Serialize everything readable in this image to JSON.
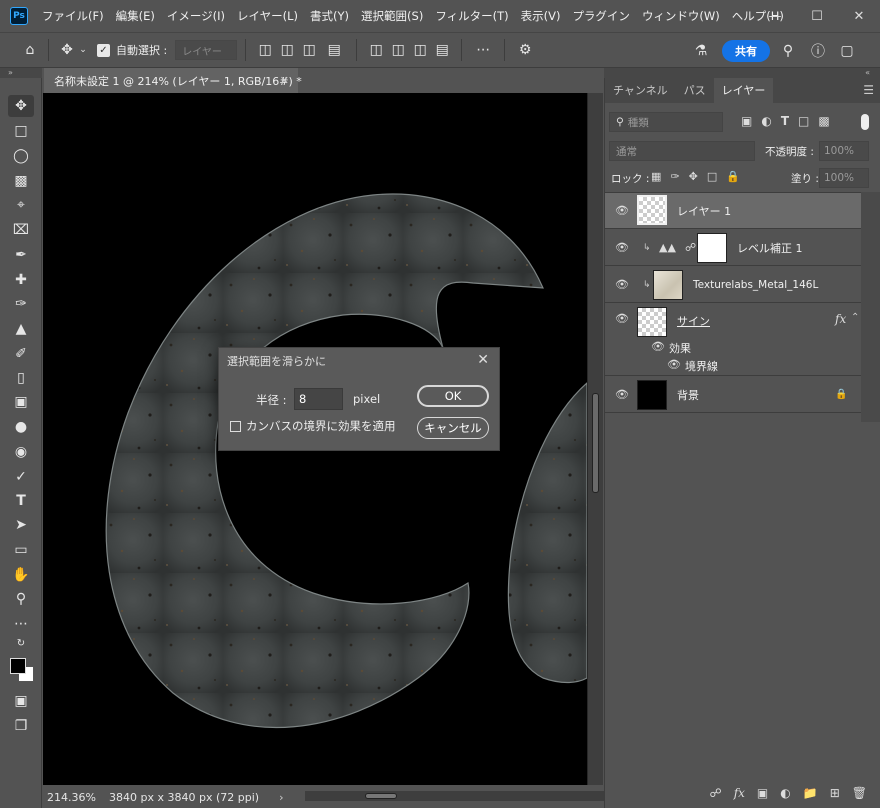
{
  "app": {
    "logo": "Ps"
  },
  "menu": [
    "ファイル(F)",
    "編集(E)",
    "イメージ(I)",
    "レイヤー(L)",
    "書式(Y)",
    "選択範囲(S)",
    "フィルター(T)",
    "表示(V)",
    "プラグイン",
    "ウィンドウ(W)",
    "ヘルプ(H)"
  ],
  "options": {
    "auto_select_label": "自動選択 :",
    "target_select": "レイヤー",
    "share_label": "共有"
  },
  "document": {
    "tab_title": "名称未設定 1 @ 214% (レイヤー 1, RGB/16#) *",
    "zoom": "214.36%",
    "dimensions": "3840 px x 3840 px (72 ppi)"
  },
  "dialog": {
    "title": "選択範囲を滑らかに",
    "radius_label": "半径 :",
    "radius_value": "8",
    "radius_unit": "pixel",
    "canvas_bounds_label": "カンバスの境界に効果を適用",
    "canvas_bounds_checked": false,
    "ok_label": "OK",
    "cancel_label": "キャンセル"
  },
  "panel": {
    "tabs": [
      "チャンネル",
      "パス",
      "レイヤー"
    ],
    "active_tab": "レイヤー",
    "filter_placeholder": "種類",
    "blend_mode": "通常",
    "opacity_label": "不透明度 :",
    "opacity_value": "100%",
    "lock_label": "ロック :",
    "fill_label": "塗り :",
    "fill_value": "100%",
    "layers": [
      {
        "name": "レイヤー 1",
        "selected": true
      },
      {
        "name": "レベル補正 1"
      },
      {
        "name": "Texturelabs_Metal_146L"
      },
      {
        "name": "サイン",
        "fx": "fx"
      },
      {
        "name": "背景"
      }
    ],
    "effects_label": "効果",
    "stroke_label": "境界線"
  }
}
